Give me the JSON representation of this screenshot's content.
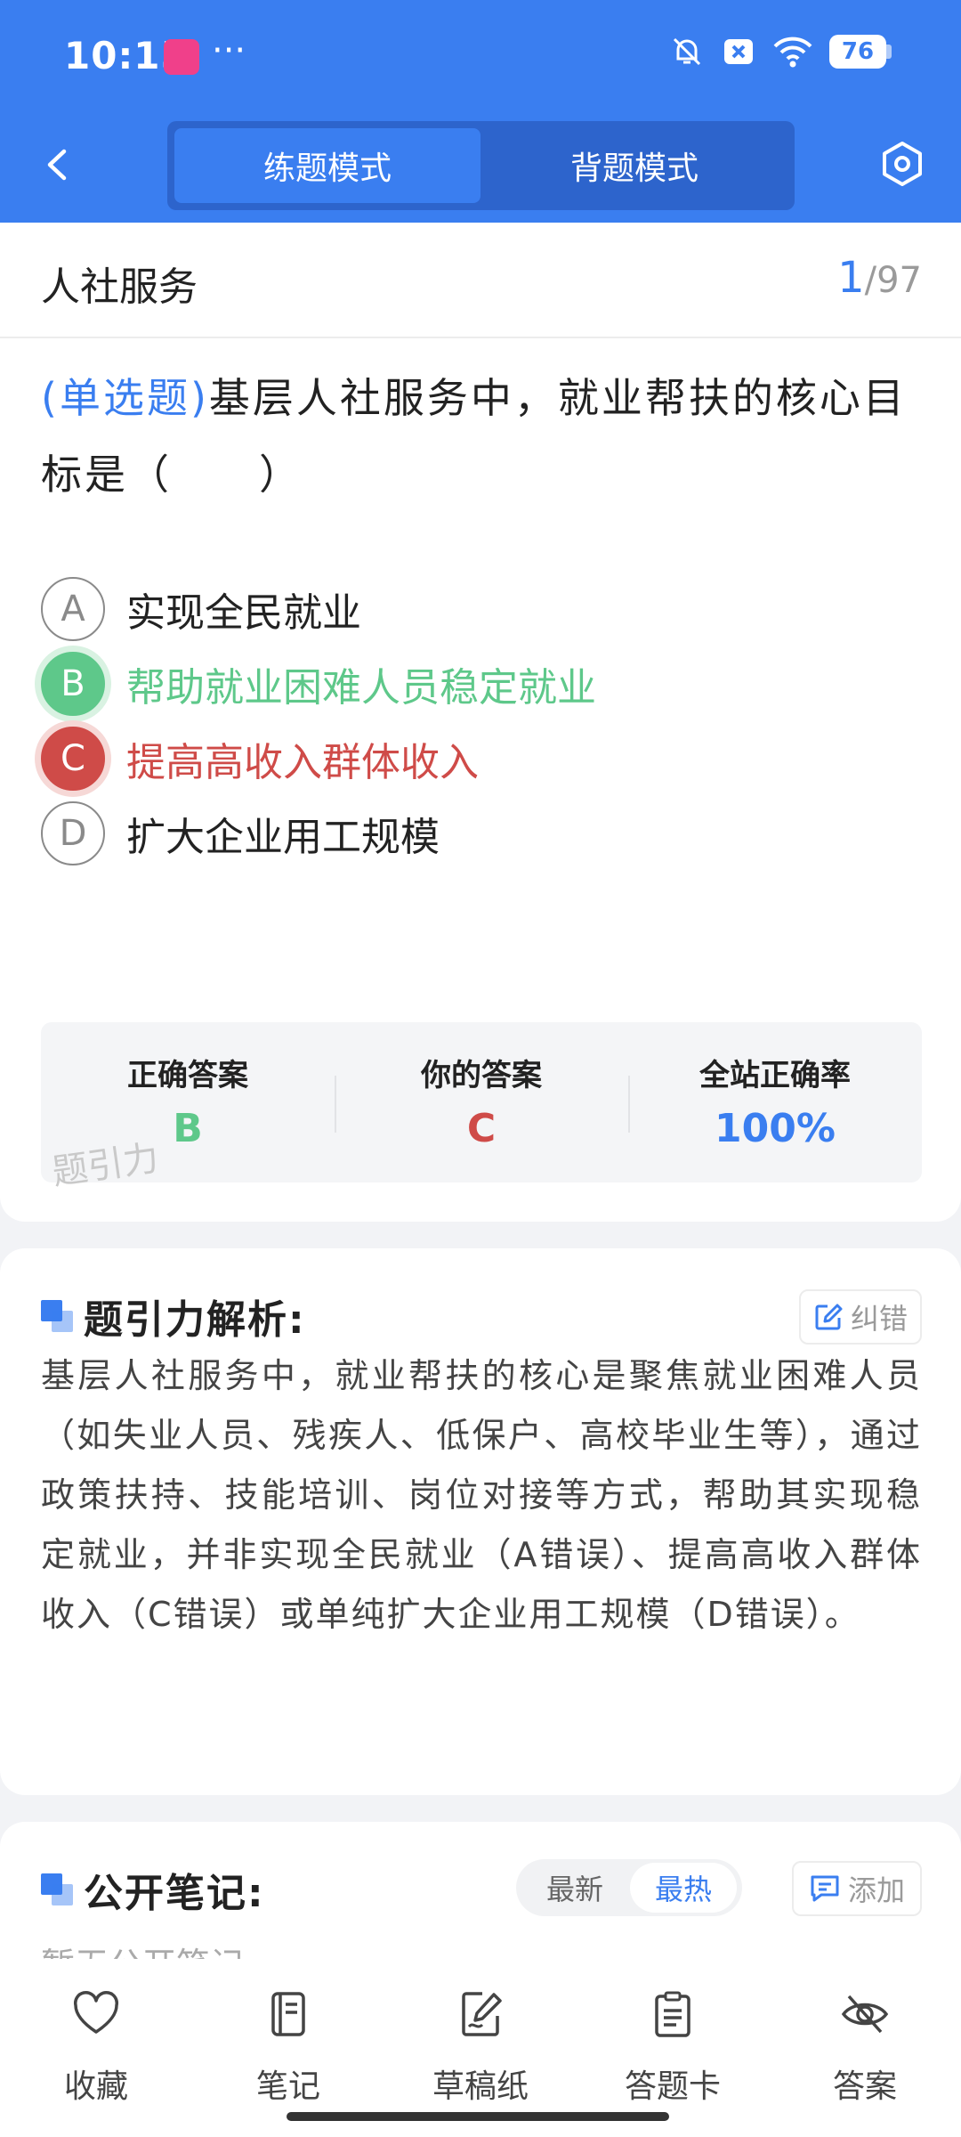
{
  "status_bar": {
    "time": "10:15",
    "more": "···",
    "battery": "76"
  },
  "header": {
    "mode_tabs": [
      {
        "label": "练题模式",
        "active": true
      },
      {
        "label": "背题模式",
        "active": false
      }
    ]
  },
  "question": {
    "subject": "人社服务",
    "progress_current": "1",
    "progress_sep": "/",
    "progress_total": "97",
    "type_label": "(单选题)",
    "text": "基层人社服务中，就业帮扶的核心目标是（　　）",
    "options": [
      {
        "letter": "A",
        "text": "实现全民就业",
        "state": "normal"
      },
      {
        "letter": "B",
        "text": "帮助就业困难人员稳定就业",
        "state": "correct"
      },
      {
        "letter": "C",
        "text": "提高高收入群体收入",
        "state": "wrong"
      },
      {
        "letter": "D",
        "text": "扩大企业用工规模",
        "state": "normal"
      }
    ]
  },
  "answer_panel": {
    "correct_label": "正确答案",
    "correct_value": "B",
    "yours_label": "你的答案",
    "yours_value": "C",
    "rate_label": "全站正确率",
    "rate_value": "100%",
    "watermark": "题引力"
  },
  "analysis": {
    "title": "题引力解析:",
    "report_label": "纠错",
    "text": "基层人社服务中，就业帮扶的核心是聚焦就业困难人员（如失业人员、残疾人、低保户、高校毕业生等），通过政策扶持、技能培训、岗位对接等方式，帮助其实现稳定就业，并非实现全民就业（A错误）、提高高收入群体收入（C错误）或单纯扩大企业用工规模（D错误）。"
  },
  "notes": {
    "title": "公开笔记:",
    "sort_latest": "最新",
    "sort_hottest": "最热",
    "add_label": "添加",
    "empty_text": "暂无公开笔记"
  },
  "bottom_nav": [
    {
      "label": "收藏",
      "icon": "heart-icon"
    },
    {
      "label": "笔记",
      "icon": "notebook-icon"
    },
    {
      "label": "草稿纸",
      "icon": "draft-paper-icon"
    },
    {
      "label": "答题卡",
      "icon": "answer-sheet-icon"
    },
    {
      "label": "答案",
      "icon": "eye-off-icon"
    }
  ],
  "colors": {
    "primary": "#3a7ef0",
    "correct": "#5ec88a",
    "wrong": "#cf4b48"
  }
}
